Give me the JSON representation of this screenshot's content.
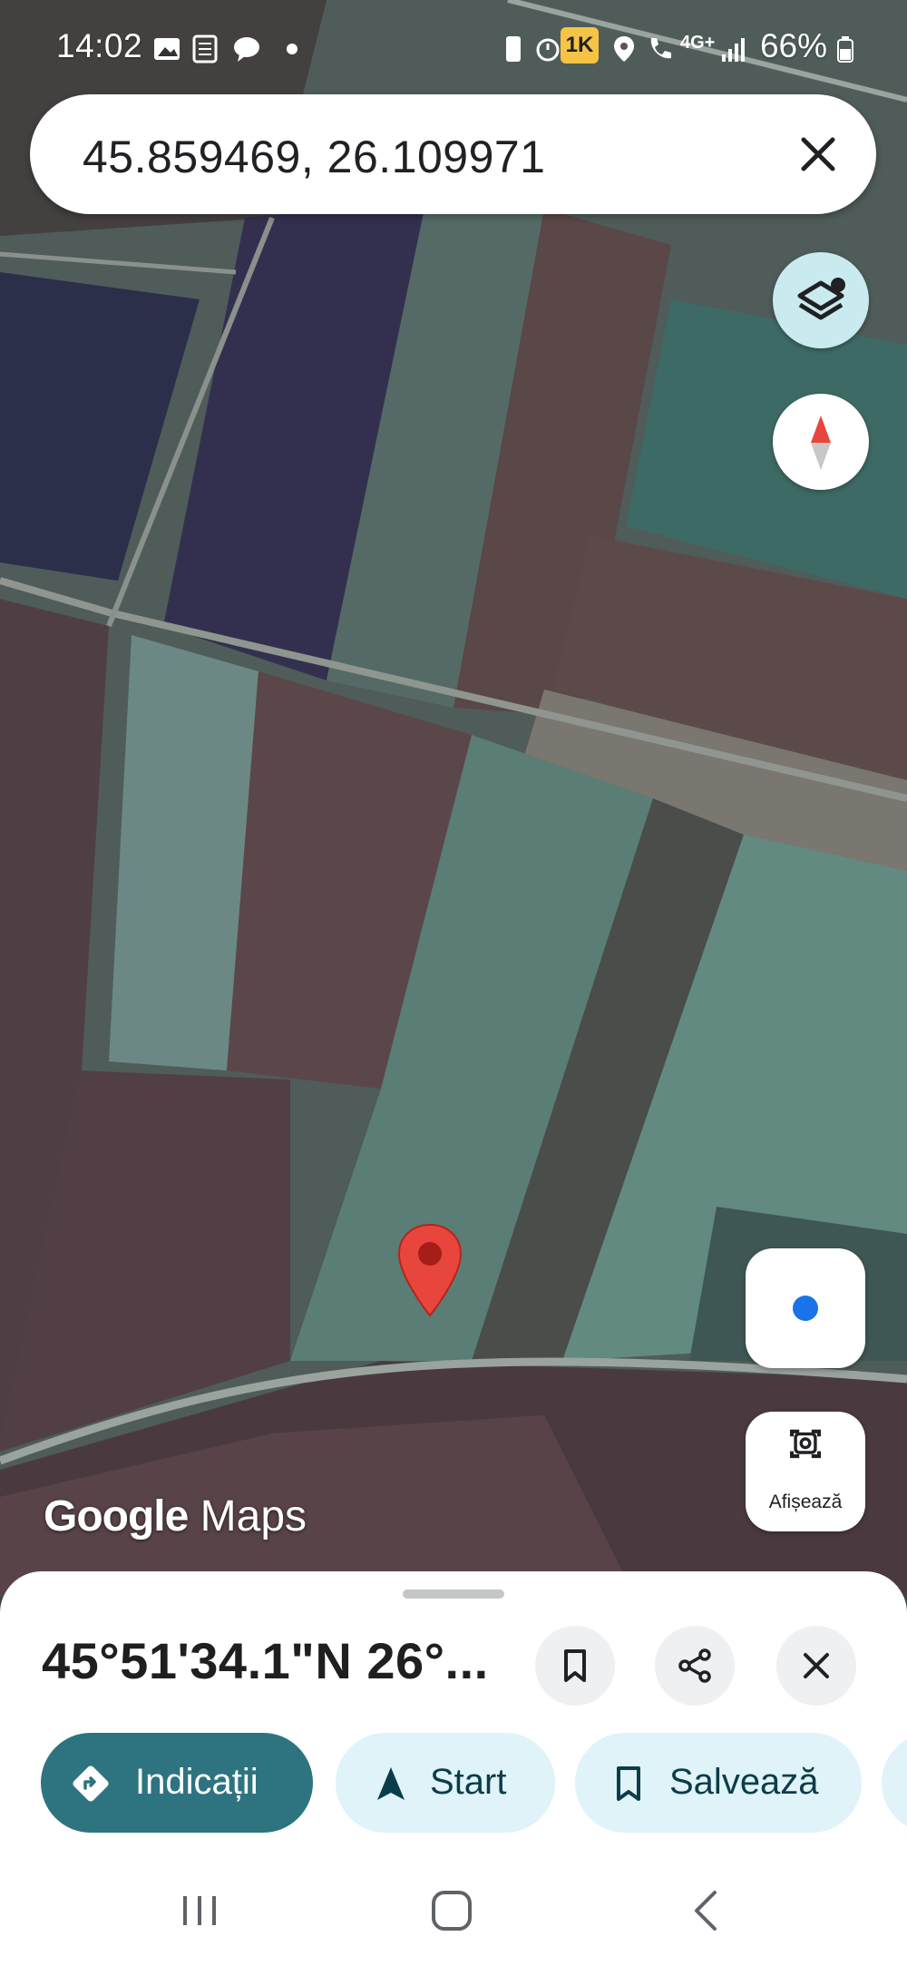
{
  "status_bar": {
    "time": "14:02",
    "badge": "1K",
    "battery": "66%",
    "network": "4G+"
  },
  "search": {
    "query": "45.859469, 26.109971"
  },
  "map": {
    "type": "satellite",
    "marker_color": "#e8453c",
    "my_location_color": "#1a73e8",
    "lens_label": "Afișează",
    "watermark_brand": "Google",
    "watermark_product": "Maps"
  },
  "sheet": {
    "title": "45°51'34.1\"N 26°...",
    "actions": {
      "directions": "Indicații",
      "start": "Start",
      "save": "Salvează"
    },
    "accent": "#2d7480",
    "chip_bg": "#dff3f8"
  },
  "icons": {
    "status": [
      "gallery-icon",
      "notes-icon",
      "chat-icon",
      "alarm-icon",
      "location-icon",
      "wifi-call-icon",
      "signal-icon",
      "battery-icon"
    ],
    "map": [
      "layers-icon",
      "compass-icon",
      "my-location-icon",
      "lens-icon",
      "marker-icon"
    ],
    "sheet": [
      "bookmark-icon",
      "share-icon",
      "close-icon",
      "directions-icon",
      "navigation-icon"
    ]
  }
}
